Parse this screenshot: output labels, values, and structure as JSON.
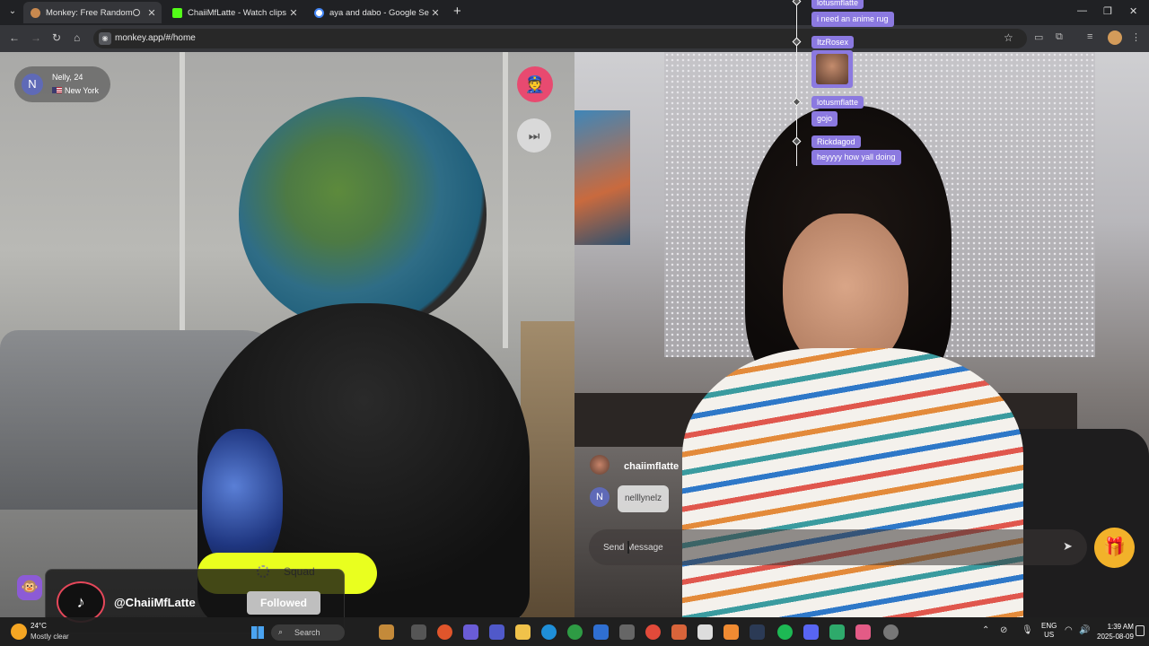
{
  "browser": {
    "tabs": [
      {
        "title": "Monkey: Free Random Vide",
        "active": true
      },
      {
        "title": "ChaiiMfLatte - Watch clips on K",
        "active": false
      },
      {
        "title": "aya and dabo - Google Search",
        "active": false
      }
    ],
    "url": "monkey.app/#/home"
  },
  "call": {
    "partner": {
      "name": "Nelly, 24",
      "location": "New York",
      "initial": "N"
    },
    "squad_label": "Squad"
  },
  "tiktok": {
    "handle": "@ChaiiMfLatte",
    "follow_label": "Followed"
  },
  "stream_chat": [
    {
      "user": "lotusmflatte",
      "message": "i need an anime rug"
    },
    {
      "user": "ItzRosex",
      "message": ""
    },
    {
      "user": "lotusmflatte",
      "message": "gojo"
    },
    {
      "user": "Rickdagod",
      "message": "heyyyy how yall doing"
    }
  ],
  "chat": {
    "sender1": "chaiimflatte",
    "sender2_initial": "N",
    "bubble": "nelllynelz",
    "placeholder": "Send Message"
  },
  "taskbar": {
    "weather_temp": "24°C",
    "weather_desc": "Mostly clear",
    "search_label": "Search",
    "lang_top": "ENG",
    "lang_bottom": "US",
    "time": "1:39 AM",
    "date": "2025-08-09"
  },
  "colors": {
    "accent_purple": "#8b79e0",
    "police_pink": "#e84a70",
    "squad_yellow": "#e9ff1f",
    "gift_orange": "#f2b22a"
  }
}
